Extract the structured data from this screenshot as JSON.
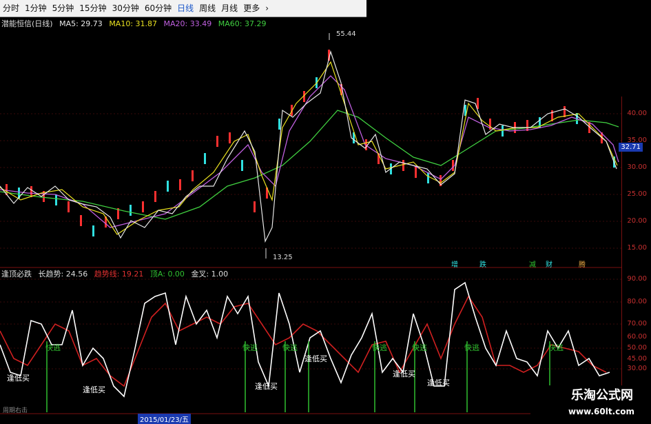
{
  "toolbar": {
    "items": [
      "分时",
      "1分钟",
      "5分钟",
      "15分钟",
      "30分钟",
      "60分钟",
      "日线",
      "周线",
      "月线",
      "更多"
    ],
    "active": "日线",
    "more_arrow": "chevron-right-icon"
  },
  "main": {
    "title": "潜能恒信(日线)",
    "ma": [
      {
        "label": "MA5: 29.73",
        "color": "#e8e8e8"
      },
      {
        "label": "MA10: 31.87",
        "color": "#e8e020"
      },
      {
        "label": "MA20: 33.49",
        "color": "#c060e0"
      },
      {
        "label": "MA60: 37.29",
        "color": "#40d040"
      }
    ],
    "high_label": "55.44",
    "low_label": "13.25",
    "current_price": "32.71",
    "ticks": [
      "40.00",
      "35.00",
      "30.00",
      "25.00",
      "20.00",
      "15.00"
    ]
  },
  "events": [
    "增",
    "跌",
    "减",
    "财",
    "腾"
  ],
  "indicator": {
    "name": "逢顶必跌",
    "long_trend": "长趋势: 24.56",
    "short_trend": "趋势线: 19.21",
    "ding": "顶A: 0.00",
    "jincha": "金叉: 1.00",
    "ticks": [
      "90.00",
      "80.00",
      "70.00",
      "60.00",
      "50.00",
      "45.00",
      "30.00"
    ],
    "signals": {
      "escape": "快逃",
      "buy": "逢低买"
    }
  },
  "footer": {
    "text": "周期右击",
    "date": "2015/01/23/五"
  },
  "watermark": {
    "title": "乐淘公式网",
    "url": "www.60lt.com"
  },
  "colors": {
    "candle_up": "#ff3030",
    "candle_down": "#30e0e0",
    "signal_green": "#30c030"
  }
}
